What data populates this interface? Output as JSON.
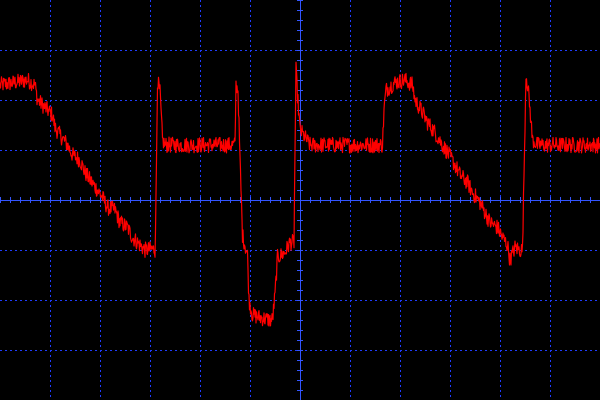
{
  "scope": {
    "background": "#000000",
    "grid_color": "#1f3cff",
    "axis_color": "#3355ff",
    "trace_color": "#ff0000",
    "grid": true,
    "divisions": {
      "horizontal": 12,
      "vertical": 8
    },
    "minor_ticks_per_division": 5
  },
  "chart_data": {
    "type": "line",
    "title": "",
    "xlabel": "",
    "ylabel": "",
    "grid": true,
    "legend": "none",
    "xlim": [
      -6,
      6
    ],
    "ylim": [
      -4,
      4
    ],
    "series": [
      {
        "color": "#ff0000",
        "noise": 0.16,
        "points": [
          [
            -6.0,
            2.3
          ],
          [
            -5.7,
            2.35
          ],
          [
            -5.45,
            2.4
          ],
          [
            -5.3,
            2.3
          ],
          [
            -5.25,
            2.0
          ],
          [
            -5.1,
            1.85
          ],
          [
            -4.95,
            1.7
          ],
          [
            -4.9,
            1.45
          ],
          [
            -4.8,
            1.3
          ],
          [
            -4.65,
            1.1
          ],
          [
            -4.55,
            0.9
          ],
          [
            -4.4,
            0.8
          ],
          [
            -4.3,
            0.55
          ],
          [
            -4.2,
            0.4
          ],
          [
            -4.05,
            0.2
          ],
          [
            -3.95,
            0.05
          ],
          [
            -3.85,
            -0.15
          ],
          [
            -3.7,
            -0.2
          ],
          [
            -3.6,
            -0.45
          ],
          [
            -3.45,
            -0.55
          ],
          [
            -3.35,
            -0.75
          ],
          [
            -3.2,
            -0.9
          ],
          [
            -3.1,
            -1.0
          ],
          [
            -2.95,
            -0.98
          ],
          [
            -2.9,
            -1.0
          ],
          [
            -2.88,
            0.0
          ],
          [
            -2.85,
            2.4
          ],
          [
            -2.8,
            2.15
          ],
          [
            -2.75,
            1.2
          ],
          [
            -2.7,
            1.1
          ],
          [
            -2.2,
            1.1
          ],
          [
            -1.75,
            1.1
          ],
          [
            -1.3,
            1.1
          ],
          [
            -1.28,
            2.3
          ],
          [
            -1.24,
            2.2
          ],
          [
            -1.2,
            0.8
          ],
          [
            -1.15,
            -0.7
          ],
          [
            -1.1,
            -0.9
          ],
          [
            -1.05,
            -1.1
          ],
          [
            -1.02,
            -2.0
          ],
          [
            -0.95,
            -2.3
          ],
          [
            -0.8,
            -2.35
          ],
          [
            -0.6,
            -2.4
          ],
          [
            -0.55,
            -2.4
          ],
          [
            -0.5,
            -1.9
          ],
          [
            -0.45,
            -1.15
          ],
          [
            -0.3,
            -1.05
          ],
          [
            -0.2,
            -0.85
          ],
          [
            -0.12,
            -0.85
          ],
          [
            -0.1,
            1.0
          ],
          [
            -0.08,
            2.6
          ],
          [
            -0.05,
            2.1
          ],
          [
            0.0,
            1.4
          ],
          [
            0.2,
            1.1
          ],
          [
            0.8,
            1.1
          ],
          [
            1.65,
            1.1
          ],
          [
            1.68,
            1.8
          ],
          [
            1.72,
            2.2
          ],
          [
            1.9,
            2.35
          ],
          [
            2.1,
            2.4
          ],
          [
            2.25,
            2.3
          ],
          [
            2.3,
            2.0
          ],
          [
            2.45,
            1.75
          ],
          [
            2.55,
            1.55
          ],
          [
            2.7,
            1.35
          ],
          [
            2.85,
            1.1
          ],
          [
            2.95,
            0.95
          ],
          [
            3.1,
            0.7
          ],
          [
            3.2,
            0.5
          ],
          [
            3.35,
            0.35
          ],
          [
            3.45,
            0.15
          ],
          [
            3.6,
            -0.05
          ],
          [
            3.7,
            -0.25
          ],
          [
            3.8,
            -0.45
          ],
          [
            3.95,
            -0.55
          ],
          [
            4.05,
            -0.75
          ],
          [
            4.15,
            -0.9
          ],
          [
            4.2,
            -1.2
          ],
          [
            4.3,
            -0.95
          ],
          [
            4.4,
            -1.0
          ],
          [
            4.45,
            -1.0
          ],
          [
            4.48,
            0.5
          ],
          [
            4.52,
            2.55
          ],
          [
            4.58,
            2.05
          ],
          [
            4.65,
            1.2
          ],
          [
            4.75,
            1.1
          ],
          [
            5.2,
            1.1
          ],
          [
            5.6,
            1.1
          ],
          [
            6.0,
            1.1
          ]
        ]
      }
    ]
  }
}
